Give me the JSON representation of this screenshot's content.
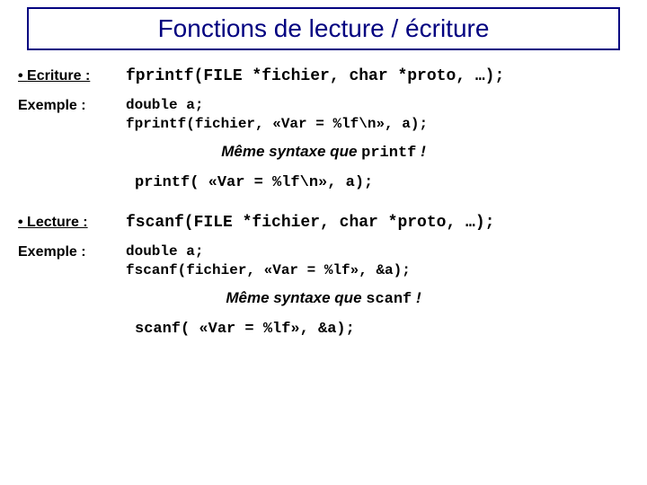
{
  "title": "Fonctions de lecture / écriture",
  "ecriture": {
    "label": "Ecriture :",
    "code": "fprintf(FILE *fichier, char *proto, …);",
    "exemple_label": "Exemple :",
    "exemple_code": "double a;\nfprintf(fichier, «Var = %lf\\n», a);",
    "note_prefix": "Même syntaxe que ",
    "note_func": "printf",
    "note_suffix": " !",
    "compare_code": "printf( «Var = %lf\\n», a);"
  },
  "lecture": {
    "label": "Lecture :",
    "code": "fscanf(FILE *fichier, char *proto, …);",
    "exemple_label": "Exemple :",
    "exemple_code": "double a;\nfscanf(fichier, «Var = %lf», &a);",
    "note_prefix": "Même syntaxe que ",
    "note_func": "scanf",
    "note_suffix": " !",
    "compare_code": "scanf( «Var = %lf», &a);"
  }
}
